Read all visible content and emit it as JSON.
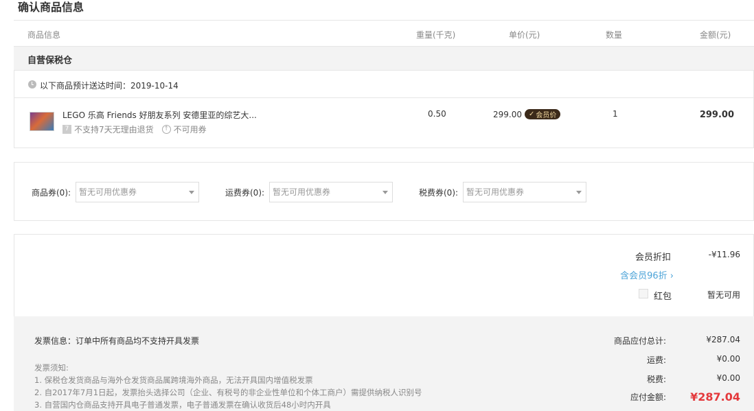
{
  "page": {
    "title": "确认商品信息"
  },
  "table_header": {
    "product": "商品信息",
    "weight": "重量(千克)",
    "unit_price": "单价(元)",
    "quantity": "数量",
    "amount": "金额(元)"
  },
  "warehouse": {
    "name": "自营保税仓"
  },
  "delivery": {
    "text": "以下商品预计送达时间：2019-10-14"
  },
  "product": {
    "name": "LEGO 乐高 Friends 好朋友系列 安德里亚的综艺大...",
    "tag_no_return": "不支持7天无理由退货",
    "tag_no_coupon": "不可用券",
    "weight": "0.50",
    "price": "299.00",
    "vip_badge": "会员价",
    "quantity": "1",
    "total": "299.00"
  },
  "coupons": {
    "goods_label": "商品券(0):",
    "goods_placeholder": "暂无可用优惠券",
    "shipping_label": "运费券(0):",
    "shipping_placeholder": "暂无可用优惠券",
    "tax_label": "税费券(0):",
    "tax_placeholder": "暂无可用优惠券"
  },
  "discount": {
    "member_label": "会员折扣",
    "member_value": "-¥11.96",
    "member_link": "含会员96折 ›",
    "redpack_label": "红包",
    "redpack_value": "暂无可用"
  },
  "invoice": {
    "title": "发票信息：订单中所有商品均不支持开具发票",
    "notes_title": "发票须知:",
    "notes": [
      "1. 保税仓发货商品与海外仓发货商品属跨境海外商品，无法开具国内增值税发票",
      "2. 自2017年7月1日起，发票抬头选择公司（企业、有税号的非企业性单位和个体工商户）需提供纳税人识别号",
      "3. 自营国内仓商品支持开具电子普通发票，电子普通发票在确认收货后48小时内开具"
    ]
  },
  "summary": {
    "goods_total_label": "商品应付总计:",
    "goods_total_value": "¥287.04",
    "shipping_label": "运费:",
    "shipping_value": "¥0.00",
    "tax_label": "税费:",
    "tax_value": "¥0.00",
    "payable_label": "应付金额:",
    "payable_value": "¥287.04"
  },
  "colors": {
    "accent_red": "#e4393c",
    "link_blue": "#4ba3d8",
    "vip_badge_bg": "#3b2a1a"
  }
}
